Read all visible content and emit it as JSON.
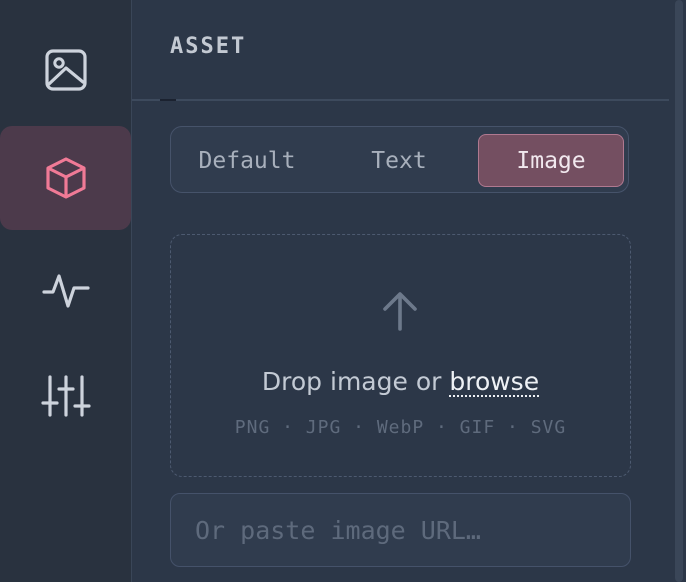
{
  "sidebar": {
    "items": [
      {
        "icon": "image-icon",
        "active": false
      },
      {
        "icon": "cube-icon",
        "active": true
      },
      {
        "icon": "activity-icon",
        "active": false
      },
      {
        "icon": "sliders-icon",
        "active": false
      }
    ]
  },
  "panel": {
    "title": "ASSET",
    "tabs": [
      {
        "label": "Default",
        "selected": false
      },
      {
        "label": "Text",
        "selected": false
      },
      {
        "label": "Image",
        "selected": true
      }
    ]
  },
  "dropzone": {
    "prompt": "Drop image or",
    "link": "browse",
    "formats": "PNG · JPG · WebP · GIF · SVG"
  },
  "url_input": {
    "placeholder": "Or paste image URL…",
    "value": ""
  },
  "colors": {
    "accent": "#f07a96",
    "active_tab_bg": "#744f61",
    "background": "#2c3748"
  }
}
